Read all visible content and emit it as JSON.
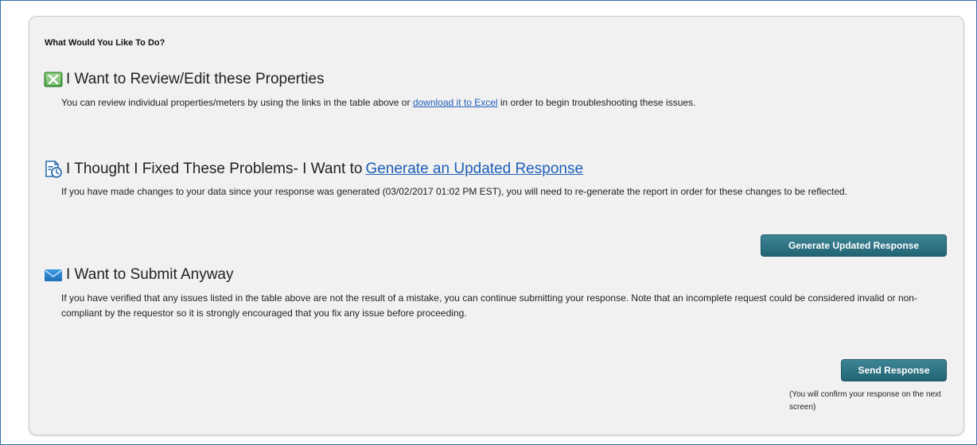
{
  "panel": {
    "heading": "What Would You Like To Do?"
  },
  "review": {
    "title": "I Want to Review/Edit these Properties",
    "text_before": "You can review individual properties/meters by using the links in the table above or ",
    "link_text": "download it to Excel",
    "text_after": " in order to begin troubleshooting these issues."
  },
  "regenerate": {
    "title_prefix": "I Thought I Fixed These Problems- I Want to ",
    "title_link": "Generate an Updated Response",
    "text": "If you have made changes to your data since your response was generated (03/02/2017 01:02 PM EST), you will need to re-generate the report in order for these changes to be reflected.",
    "button_label": "Generate Updated Response"
  },
  "submit": {
    "title": "I Want to Submit Anyway",
    "text": "If you have verified that any issues listed in the table above are not the result of a mistake, you can continue submitting your response. Note that an incomplete request could be considered invalid or non-compliant by the requestor so it is strongly encouraged that you fix any issue before proceeding.",
    "button_label": "Send Response",
    "note": "(You will confirm your response on the next screen)"
  },
  "icons": {
    "review": "excel-icon",
    "regenerate": "report-clock-icon",
    "submit": "envelope-icon"
  },
  "colors": {
    "button": "#236474",
    "link": "#1f5fb8",
    "frame_border": "#3b6fa8",
    "panel_background": "#f1f1f1"
  }
}
